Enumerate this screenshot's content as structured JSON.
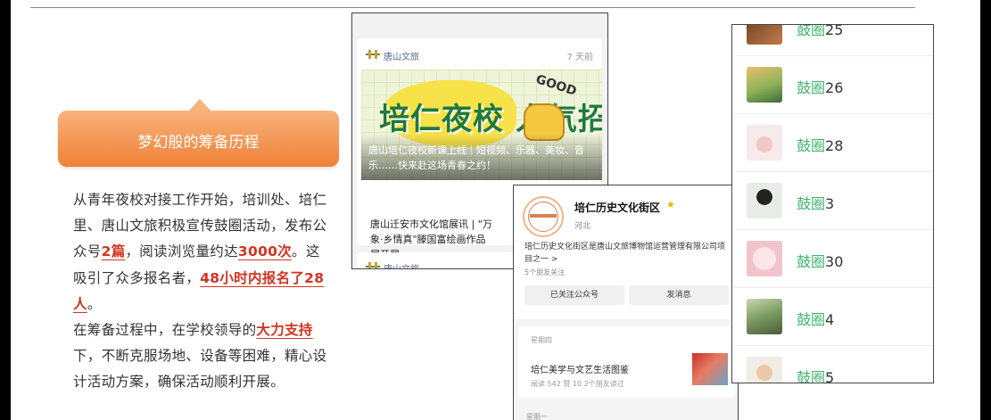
{
  "heading": {
    "text": "梦幻般的筹备历程"
  },
  "paragraph": {
    "p1_a": "从青年夜校对接工作开始，培训处、培仁里、唐山文旅积极宣传鼓圈活动，发布公众号",
    "p1_hl1": "2篇",
    "p1_b": "，阅读浏览量约达",
    "p1_hl2": "3000次",
    "p1_c": "。这吸引了众多报名者，",
    "p1_hl3": "48小时内报名了28人",
    "p1_d": "。",
    "p2_a": "在筹备过程中，在学校领导的",
    "p2_hl": "大力支持",
    "p2_b": "下，不断克服场地、设备等困难，精心设计活动方案，确保活动顺利开展。"
  },
  "feed": {
    "account": "唐山文旅",
    "time": "7 天前",
    "banner_title": "培仁夜校  人气招生中",
    "banner_badge": "GOOD",
    "banner_caption": "唐山培仁夜校新课上线｜短视频、乐器、美妆、音乐……快来赴这场青春之约！",
    "second_article": "唐山迁安市文化馆展讯 | \"万象·乡情真\"滕国富绘画作品展开展",
    "account_2": "唐山文旅"
  },
  "profile": {
    "name": "培仁历史文化街区",
    "region": "河北",
    "description": "培仁历史文化街区是唐山文旅博物馆运营管理有限公司项目之一 >",
    "friends": "5个朋友关注",
    "followed_button": "已关注公众号",
    "message_button": "发消息",
    "day_1": "星期四",
    "article_title": "培仁美学与文艺生活图鉴",
    "article_stats": "阅读 542  赞 10  2个朋友读过",
    "day_2": "星期一"
  },
  "groups": {
    "prefix": "鼓圈",
    "items": [
      {
        "num": "25"
      },
      {
        "num": "26"
      },
      {
        "num": "28"
      },
      {
        "num": "3"
      },
      {
        "num": "30"
      },
      {
        "num": "4"
      },
      {
        "num": "5"
      }
    ]
  },
  "colors": {
    "accent_orange": "#ef8136",
    "highlight_red": "#d43322",
    "wechat_green": "#3fb46a",
    "link_blue": "#576b95"
  }
}
